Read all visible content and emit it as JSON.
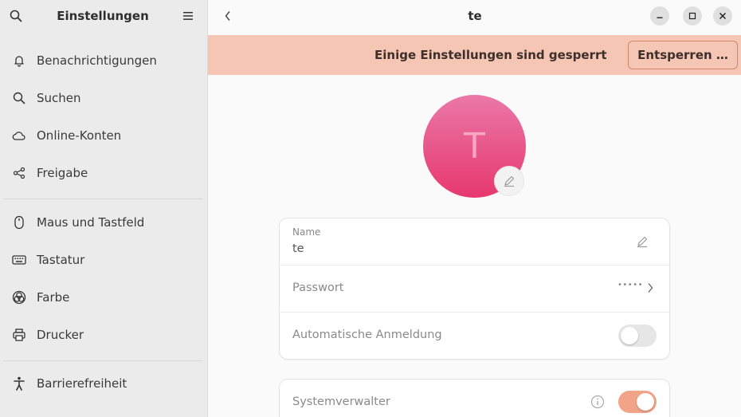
{
  "sidebar": {
    "title": "Einstellungen",
    "items": [
      {
        "label": "Benachrichtigungen",
        "icon": "bell-icon"
      },
      {
        "label": "Suchen",
        "icon": "search-icon"
      },
      {
        "label": "Online-Konten",
        "icon": "cloud-icon"
      },
      {
        "label": "Freigabe",
        "icon": "share-icon"
      },
      {
        "label": "Maus und Tastfeld",
        "icon": "mouse-icon"
      },
      {
        "label": "Tastatur",
        "icon": "keyboard-icon"
      },
      {
        "label": "Farbe",
        "icon": "color-icon"
      },
      {
        "label": "Drucker",
        "icon": "printer-icon"
      },
      {
        "label": "Barrierefreiheit",
        "icon": "accessibility-icon"
      }
    ]
  },
  "header": {
    "title": "te",
    "back_icon": "chevron-left-icon"
  },
  "banner": {
    "text": "Einige Einstellungen sind gesperrt",
    "unlock_label": "Entsperren …"
  },
  "avatar": {
    "initial": "T"
  },
  "account": {
    "name_label": "Name",
    "name_value": "te",
    "password_label": "Passwort",
    "password_value": "•••••",
    "autologin_label": "Automatische Anmeldung",
    "autologin_enabled": false,
    "admin_label": "Systemverwalter",
    "admin_enabled": true
  },
  "colors": {
    "banner_bg": "#f6c6b4",
    "accent": "#f2a488",
    "avatar_top": "#ea78a8",
    "avatar_bottom": "#e7386f"
  }
}
